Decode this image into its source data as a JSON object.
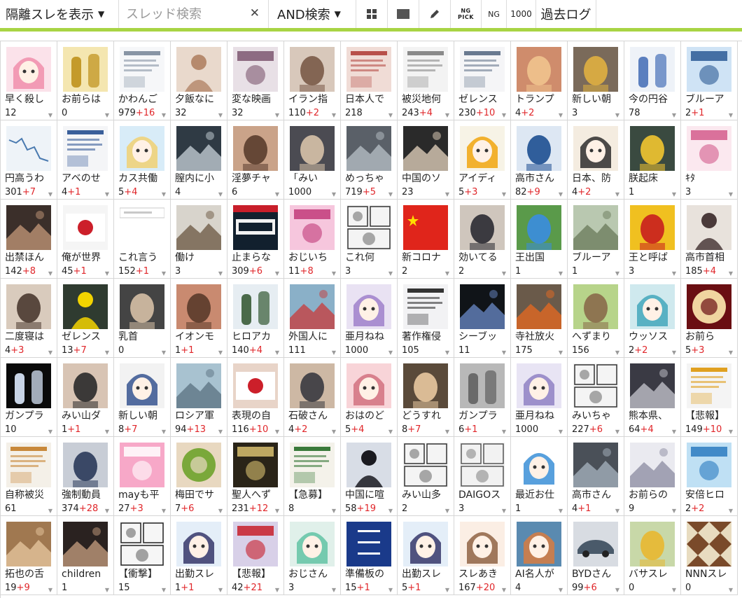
{
  "toolbar": {
    "hide_toggle_label": "隔離スレを表示",
    "search_placeholder": "スレッド検索",
    "search_mode_label": "AND検索",
    "ng_pick_label_top": "NG",
    "ng_pick_label_bottom": "PICK",
    "ng_label": "NG",
    "count_label": "1000",
    "past_log_label": "過去ログ"
  },
  "colors": {
    "accent": "#a8d444",
    "new_count": "#e0262a"
  },
  "threads": [
    {
      "title": "早く殺し",
      "count": "12",
      "new": "",
      "thumb": {
        "bg": "#fbe2ea",
        "fg": "#f08aa8",
        "kind": "anime"
      }
    },
    {
      "title": "お前らは",
      "count": "0",
      "new": "",
      "thumb": {
        "bg": "#f4e6b0",
        "fg": "#c49a2a",
        "kind": "figures"
      }
    },
    {
      "title": "かわんご",
      "count": "979",
      "new": "+16",
      "thumb": {
        "bg": "#f6f7f9",
        "fg": "#8895a5",
        "kind": "doc"
      }
    },
    {
      "title": "夕飯なに",
      "count": "32",
      "new": "",
      "thumb": {
        "bg": "#e9d9cc",
        "fg": "#b68a6d",
        "kind": "person"
      }
    },
    {
      "title": "変な映画",
      "count": "32",
      "new": "",
      "thumb": {
        "bg": "#e8e0e6",
        "fg": "#7d5670",
        "kind": "poster"
      }
    },
    {
      "title": "イラン指",
      "count": "110",
      "new": "+2",
      "thumb": {
        "bg": "#d8c8bb",
        "fg": "#7a5a48",
        "kind": "face"
      }
    },
    {
      "title": "日本人で",
      "count": "218",
      "new": "",
      "thumb": {
        "bg": "#f0dcd6",
        "fg": "#b8504a",
        "kind": "doc"
      }
    },
    {
      "title": "被災地何",
      "count": "243",
      "new": "+4",
      "thumb": {
        "bg": "#f3f3f3",
        "fg": "#8a8a8a",
        "kind": "doc"
      }
    },
    {
      "title": "ゼレンス",
      "count": "230",
      "new": "+10",
      "thumb": {
        "bg": "#f5f5f7",
        "fg": "#6a7a90",
        "kind": "doc"
      }
    },
    {
      "title": "トランプ",
      "count": "4",
      "new": "+2",
      "thumb": {
        "bg": "#cf8c6c",
        "fg": "#f0c38e",
        "kind": "face"
      }
    },
    {
      "title": "新しい朝",
      "count": "3",
      "new": "",
      "thumb": {
        "bg": "#7a6a5a",
        "fg": "#e0b040",
        "kind": "face"
      }
    },
    {
      "title": "今の円谷",
      "count": "78",
      "new": "",
      "thumb": {
        "bg": "#eef2f8",
        "fg": "#5b7fbf",
        "kind": "figures"
      }
    },
    {
      "title": "ブルーア",
      "count": "2",
      "new": "+1",
      "thumb": {
        "bg": "#cfe3f5",
        "fg": "#2c5a95",
        "kind": "poster"
      }
    },
    {
      "title": "円高うわ",
      "count": "301",
      "new": "+7",
      "thumb": {
        "bg": "#eef3f8",
        "fg": "#4a7ab0",
        "kind": "chart"
      }
    },
    {
      "title": "アベのせ",
      "count": "4",
      "new": "+1",
      "thumb": {
        "bg": "#f4f5f7",
        "fg": "#3a5f9a",
        "kind": "doc"
      }
    },
    {
      "title": "カス共働",
      "count": "5",
      "new": "+4",
      "thumb": {
        "bg": "#d8ecf8",
        "fg": "#f2cf6a",
        "kind": "anime"
      }
    },
    {
      "title": "膣内に小",
      "count": "4",
      "new": "",
      "thumb": {
        "bg": "#2f3a44",
        "fg": "#c9d3da",
        "kind": "photo"
      }
    },
    {
      "title": "淫夢チャ",
      "count": "6",
      "new": "",
      "thumb": {
        "bg": "#caa389",
        "fg": "#5a3d2e",
        "kind": "face"
      }
    },
    {
      "title": "「みい",
      "count": "1000",
      "new": "",
      "thumb": {
        "bg": "#4b4b52",
        "fg": "#d7c2a8",
        "kind": "face"
      }
    },
    {
      "title": "めっちゃ",
      "count": "719",
      "new": "+5",
      "thumb": {
        "bg": "#5a6068",
        "fg": "#b9c1c8",
        "kind": "photo"
      }
    },
    {
      "title": "中国のソ",
      "count": "23",
      "new": "",
      "thumb": {
        "bg": "#2a2a2a",
        "fg": "#e7d6c0",
        "kind": "photo"
      }
    },
    {
      "title": "アイディ",
      "count": "5",
      "new": "+3",
      "thumb": {
        "bg": "#f7f3e6",
        "fg": "#f0a000",
        "kind": "anime"
      }
    },
    {
      "title": "高市さん",
      "count": "82",
      "new": "+9",
      "thumb": {
        "bg": "#dde7f3",
        "fg": "#1d4f91",
        "kind": "face"
      }
    },
    {
      "title": "日本、防",
      "count": "4",
      "new": "+2",
      "thumb": {
        "bg": "#f4ece0",
        "fg": "#222222",
        "kind": "anime"
      }
    },
    {
      "title": "朕起床",
      "count": "1",
      "new": "",
      "thumb": {
        "bg": "#3a4a40",
        "fg": "#f2c530",
        "kind": "face"
      }
    },
    {
      "title": "ｷﾀ",
      "count": "3",
      "new": "",
      "thumb": {
        "bg": "#fbe8ef",
        "fg": "#d45c8c",
        "kind": "poster"
      }
    },
    {
      "title": "出禁ほん",
      "count": "142",
      "new": "+8",
      "thumb": {
        "bg": "#3b2f2a",
        "fg": "#c59a7a",
        "kind": "photo"
      }
    },
    {
      "title": "俺が世界",
      "count": "45",
      "new": "+1",
      "thumb": {
        "bg": "#f5f5f5",
        "fg": "#cc1f2a",
        "kind": "flag"
      }
    },
    {
      "title": "これ言う",
      "count": "152",
      "new": "+1",
      "thumb": {
        "bg": "#ffffff",
        "fg": "#c8c8c8",
        "kind": "strip"
      }
    },
    {
      "title": "働け",
      "count": "3",
      "new": "",
      "thumb": {
        "bg": "#d8d4cc",
        "fg": "#6a5640",
        "kind": "photo"
      }
    },
    {
      "title": "止まらな",
      "count": "309",
      "new": "+6",
      "thumb": {
        "bg": "#12202e",
        "fg": "#f2f2f2",
        "kind": "number"
      }
    },
    {
      "title": "おじいち",
      "count": "11",
      "new": "+8",
      "thumb": {
        "bg": "#f6c6dd",
        "fg": "#c23a7a",
        "kind": "poster"
      }
    },
    {
      "title": "これ何",
      "count": "3",
      "new": "",
      "thumb": {
        "bg": "#f4f4f4",
        "fg": "#333333",
        "kind": "manga"
      }
    },
    {
      "title": "新コロナ",
      "count": "2",
      "new": "",
      "thumb": {
        "bg": "#e0251b",
        "fg": "#ffde00",
        "kind": "cnflag"
      }
    },
    {
      "title": "効いてる",
      "count": "2",
      "new": "",
      "thumb": {
        "bg": "#cfc6bd",
        "fg": "#2a2a32",
        "kind": "face"
      }
    },
    {
      "title": "王出国",
      "count": "1",
      "new": "",
      "thumb": {
        "bg": "#5a9a4a",
        "fg": "#3a8de0",
        "kind": "face"
      }
    },
    {
      "title": "ブルーア",
      "count": "1",
      "new": "",
      "thumb": {
        "bg": "#b9c8b0",
        "fg": "#6a7a5a",
        "kind": "photo"
      }
    },
    {
      "title": "王と呼ば",
      "count": "3",
      "new": "",
      "thumb": {
        "bg": "#f0c020",
        "fg": "#c81e1e",
        "kind": "face"
      }
    },
    {
      "title": "高市首相",
      "count": "185",
      "new": "+4",
      "thumb": {
        "bg": "#e8e2dc",
        "fg": "#4a3a3a",
        "kind": "person"
      }
    },
    {
      "title": "二度寝は",
      "count": "4",
      "new": "+3",
      "thumb": {
        "bg": "#d9cbbd",
        "fg": "#4a3a30",
        "kind": "face"
      }
    },
    {
      "title": "ゼレンス",
      "count": "13",
      "new": "+7",
      "thumb": {
        "bg": "#2f3b30",
        "fg": "#f2d400",
        "kind": "person"
      }
    },
    {
      "title": "乳首",
      "count": "0",
      "new": "",
      "thumb": {
        "bg": "#444444",
        "fg": "#d6c0a6",
        "kind": "face"
      }
    },
    {
      "title": "イオンモ",
      "count": "1",
      "new": "+1",
      "thumb": {
        "bg": "#c98a70",
        "fg": "#5a3a2a",
        "kind": "face"
      }
    },
    {
      "title": "ヒロアカ",
      "count": "140",
      "new": "+4",
      "thumb": {
        "bg": "#e6edf2",
        "fg": "#4a6a4a",
        "kind": "figures"
      }
    },
    {
      "title": "外国人に",
      "count": "111",
      "new": "",
      "thumb": {
        "bg": "#8ab0c8",
        "fg": "#c83a3a",
        "kind": "photo"
      }
    },
    {
      "title": "亜月ねね",
      "count": "1000",
      "new": "",
      "thumb": {
        "bg": "#e9e2f3",
        "fg": "#9a7ac8",
        "kind": "anime"
      }
    },
    {
      "title": "著作権侵",
      "count": "105",
      "new": "",
      "thumb": {
        "bg": "#f2f2f4",
        "fg": "#333333",
        "kind": "doc"
      }
    },
    {
      "title": "シーブッ",
      "count": "11",
      "new": "",
      "thumb": {
        "bg": "#101418",
        "fg": "#6a8ac8",
        "kind": "photo"
      }
    },
    {
      "title": "寺社放火",
      "count": "175",
      "new": "",
      "thumb": {
        "bg": "#6a5a4a",
        "fg": "#e86a20",
        "kind": "photo"
      }
    },
    {
      "title": "へずまり",
      "count": "156",
      "new": "",
      "thumb": {
        "bg": "#b7d48a",
        "fg": "#8a6a4a",
        "kind": "face"
      }
    },
    {
      "title": "ウッソス",
      "count": "2",
      "new": "+2",
      "thumb": {
        "bg": "#cfe9ee",
        "fg": "#3aa3b8",
        "kind": "anime"
      }
    },
    {
      "title": "お前ら",
      "count": "5",
      "new": "+3",
      "thumb": {
        "bg": "#6a0e12",
        "fg": "#f0d5a0",
        "kind": "circle"
      }
    },
    {
      "title": "ガンプラ",
      "count": "10",
      "new": "",
      "thumb": {
        "bg": "#0a0a0a",
        "fg": "#c8d4e6",
        "kind": "figures"
      }
    },
    {
      "title": "みい山ダ",
      "count": "1",
      "new": "+1",
      "thumb": {
        "bg": "#d8c4b4",
        "fg": "#2a2a2a",
        "kind": "face"
      }
    },
    {
      "title": "新しい朝",
      "count": "8",
      "new": "+7",
      "thumb": {
        "bg": "#f2f2f2",
        "fg": "#2a4a8a",
        "kind": "anime"
      }
    },
    {
      "title": "ロシア軍",
      "count": "94",
      "new": "+13",
      "thumb": {
        "bg": "#a8c2d0",
        "fg": "#5a7080",
        "kind": "photo"
      }
    },
    {
      "title": "表現の自",
      "count": "116",
      "new": "+10",
      "thumb": {
        "bg": "#e8d4c8",
        "fg": "#cc1f2a",
        "kind": "flag"
      }
    },
    {
      "title": "石破さん",
      "count": "4",
      "new": "+2",
      "thumb": {
        "bg": "#cdb8a4",
        "fg": "#3a3a40",
        "kind": "face"
      }
    },
    {
      "title": "おはのど",
      "count": "5",
      "new": "+4",
      "thumb": {
        "bg": "#f8d4d8",
        "fg": "#d06a7a",
        "kind": "anime"
      }
    },
    {
      "title": "どうすれ",
      "count": "8",
      "new": "+7",
      "thumb": {
        "bg": "#5a4a3a",
        "fg": "#e8c8a0",
        "kind": "face"
      }
    },
    {
      "title": "ガンプラ",
      "count": "6",
      "new": "+1",
      "thumb": {
        "bg": "#b8b8b8",
        "fg": "#6a6a6a",
        "kind": "figures"
      }
    },
    {
      "title": "亜月ねね",
      "count": "1000",
      "new": "",
      "thumb": {
        "bg": "#e8e4f4",
        "fg": "#8a7ac0",
        "kind": "anime"
      }
    },
    {
      "title": "みいちゃ",
      "count": "227",
      "new": "+6",
      "thumb": {
        "bg": "#f4f4f4",
        "fg": "#333333",
        "kind": "manga"
      }
    },
    {
      "title": "熊本県、",
      "count": "64",
      "new": "+4",
      "thumb": {
        "bg": "#3a3a44",
        "fg": "#c8c8d0",
        "kind": "photo"
      }
    },
    {
      "title": "【悲報】",
      "count": "149",
      "new": "+10",
      "thumb": {
        "bg": "#f4f4f4",
        "fg": "#e0a020",
        "kind": "doc"
      }
    },
    {
      "title": "自称被災",
      "count": "61",
      "new": "",
      "thumb": {
        "bg": "#f4f0e8",
        "fg": "#c8883a",
        "kind": "doc"
      }
    },
    {
      "title": "強制動員",
      "count": "374",
      "new": "+28",
      "thumb": {
        "bg": "#c8cdd6",
        "fg": "#2a3a5a",
        "kind": "face"
      }
    },
    {
      "title": "mayも平",
      "count": "27",
      "new": "+3",
      "thumb": {
        "bg": "#f7a8c8",
        "fg": "#ffffff",
        "kind": "poster"
      }
    },
    {
      "title": "梅田でサ",
      "count": "7",
      "new": "+6",
      "thumb": {
        "bg": "#e8d8c0",
        "fg": "#7aa83a",
        "kind": "circle"
      }
    },
    {
      "title": "聖人へず",
      "count": "231",
      "new": "+12",
      "thumb": {
        "bg": "#2a2418",
        "fg": "#d8c070",
        "kind": "poster"
      }
    },
    {
      "title": "【急募】",
      "count": "8",
      "new": "",
      "thumb": {
        "bg": "#f4f2ea",
        "fg": "#3a7a3a",
        "kind": "doc"
      }
    },
    {
      "title": "中国に喧",
      "count": "58",
      "new": "+19",
      "thumb": {
        "bg": "#d8dde6",
        "fg": "#1a1a20",
        "kind": "person"
      }
    },
    {
      "title": "みい山多",
      "count": "2",
      "new": "",
      "thumb": {
        "bg": "#f4f4f4",
        "fg": "#333333",
        "kind": "manga"
      }
    },
    {
      "title": "DAIGOス",
      "count": "3",
      "new": "",
      "thumb": {
        "bg": "#f2f2f2",
        "fg": "#555555",
        "kind": "manga"
      }
    },
    {
      "title": "最近お仕",
      "count": "1",
      "new": "",
      "thumb": {
        "bg": "#ffffff",
        "fg": "#2e88d4",
        "kind": "anime"
      }
    },
    {
      "title": "高市さん",
      "count": "4",
      "new": "+1",
      "thumb": {
        "bg": "#4a5058",
        "fg": "#a8b4c0",
        "kind": "photo"
      }
    },
    {
      "title": "お前らの",
      "count": "9",
      "new": "",
      "thumb": {
        "bg": "#eaeaf0",
        "fg": "#8a8aa0",
        "kind": "photo"
      }
    },
    {
      "title": "安倍ヒロ",
      "count": "2",
      "new": "+2",
      "thumb": {
        "bg": "#bfe0f4",
        "fg": "#2a7ac0",
        "kind": "poster"
      }
    },
    {
      "title": "拓也の舌",
      "count": "19",
      "new": "+9",
      "thumb": {
        "bg": "#a07850",
        "fg": "#e8c8a0",
        "kind": "photo"
      }
    },
    {
      "title": "children",
      "count": "1",
      "new": "",
      "thumb": {
        "bg": "#2a2220",
        "fg": "#c8a080",
        "kind": "photo"
      }
    },
    {
      "title": "【衝撃】",
      "count": "15",
      "new": "",
      "thumb": {
        "bg": "#f6f6f6",
        "fg": "#222222",
        "kind": "manga"
      }
    },
    {
      "title": "出勤スレ",
      "count": "1",
      "new": "+1",
      "thumb": {
        "bg": "#e4eef8",
        "fg": "#2a2a60",
        "kind": "anime"
      }
    },
    {
      "title": "【悲報】",
      "count": "42",
      "new": "+21",
      "thumb": {
        "bg": "#d8d0e8",
        "fg": "#c81e2a",
        "kind": "poster"
      }
    },
    {
      "title": "おじさん",
      "count": "3",
      "new": "",
      "thumb": {
        "bg": "#e0f0ea",
        "fg": "#5ac0a0",
        "kind": "anime"
      }
    },
    {
      "title": "準備板の",
      "count": "15",
      "new": "+1",
      "thumb": {
        "bg": "#1a3a8a",
        "fg": "#ffffff",
        "kind": "sign"
      }
    },
    {
      "title": "出勤スレ",
      "count": "5",
      "new": "+1",
      "thumb": {
        "bg": "#e4eef8",
        "fg": "#2a2a60",
        "kind": "anime"
      }
    },
    {
      "title": "スレあき",
      "count": "167",
      "new": "+20",
      "thumb": {
        "bg": "#fbeee4",
        "fg": "#8a5a3a",
        "kind": "anime"
      }
    },
    {
      "title": "AI名人が",
      "count": "4",
      "new": "",
      "thumb": {
        "bg": "#5a8ab0",
        "fg": "#e07a3a",
        "kind": "anime"
      }
    },
    {
      "title": "BYDさん",
      "count": "99",
      "new": "+6",
      "thumb": {
        "bg": "#d8dce2",
        "fg": "#4a5a6a",
        "kind": "car"
      }
    },
    {
      "title": "バサスレ",
      "count": "0",
      "new": "",
      "thumb": {
        "bg": "#c8d8a8",
        "fg": "#e8b830",
        "kind": "face"
      }
    },
    {
      "title": "NNNスレ",
      "count": "0",
      "new": "",
      "thumb": {
        "bg": "#7a4a2a",
        "fg": "#e8dcc0",
        "kind": "pattern"
      }
    }
  ]
}
